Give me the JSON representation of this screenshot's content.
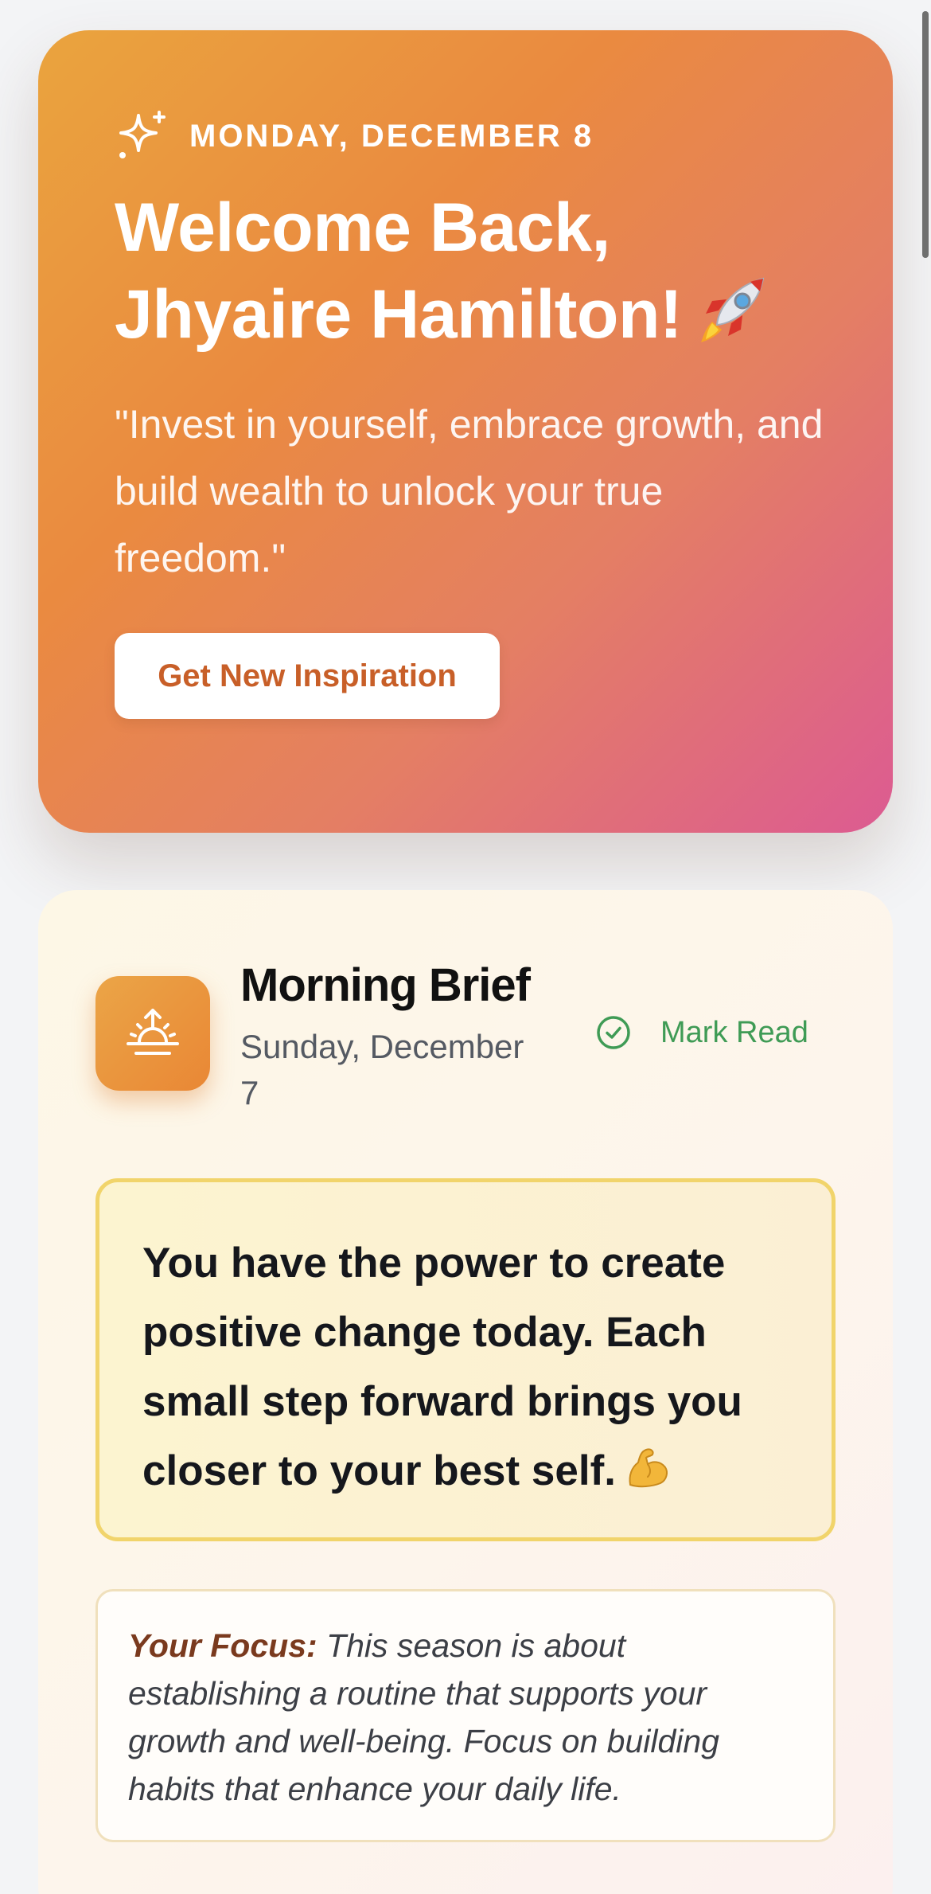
{
  "hero": {
    "date": "MONDAY, DECEMBER 8",
    "welcome_line1": "Welcome Back,",
    "welcome_line2": "Jhyaire Hamilton!",
    "quote": "\"Invest in yourself, embrace growth, and build wealth to unlock your true freedom.\"",
    "button_label": "Get New Inspiration",
    "icons": [
      "sparkle-icon",
      "rocket-icon"
    ]
  },
  "brief": {
    "title": "Morning Brief",
    "date": "Sunday, December 7",
    "mark_read_label": "Mark Read",
    "affirmation": "You have the power to create positive change today. Each small step forward brings you closer to your best self.",
    "focus_label": "Your Focus:",
    "focus_text": "This season is about establishing a routine that supports your growth and well-being. Focus on building habits that enhance your daily life.",
    "icons": [
      "sunrise-icon",
      "check-circle-icon",
      "flexed-biceps-icon"
    ]
  },
  "colors": {
    "hero_gradient_start": "#eaa43e",
    "hero_gradient_end": "#dc5b92",
    "button_text": "#c85f28",
    "mark_read_green": "#3f9b55",
    "affirmation_border": "#f1d46b",
    "focus_label": "#7a3a1e"
  }
}
